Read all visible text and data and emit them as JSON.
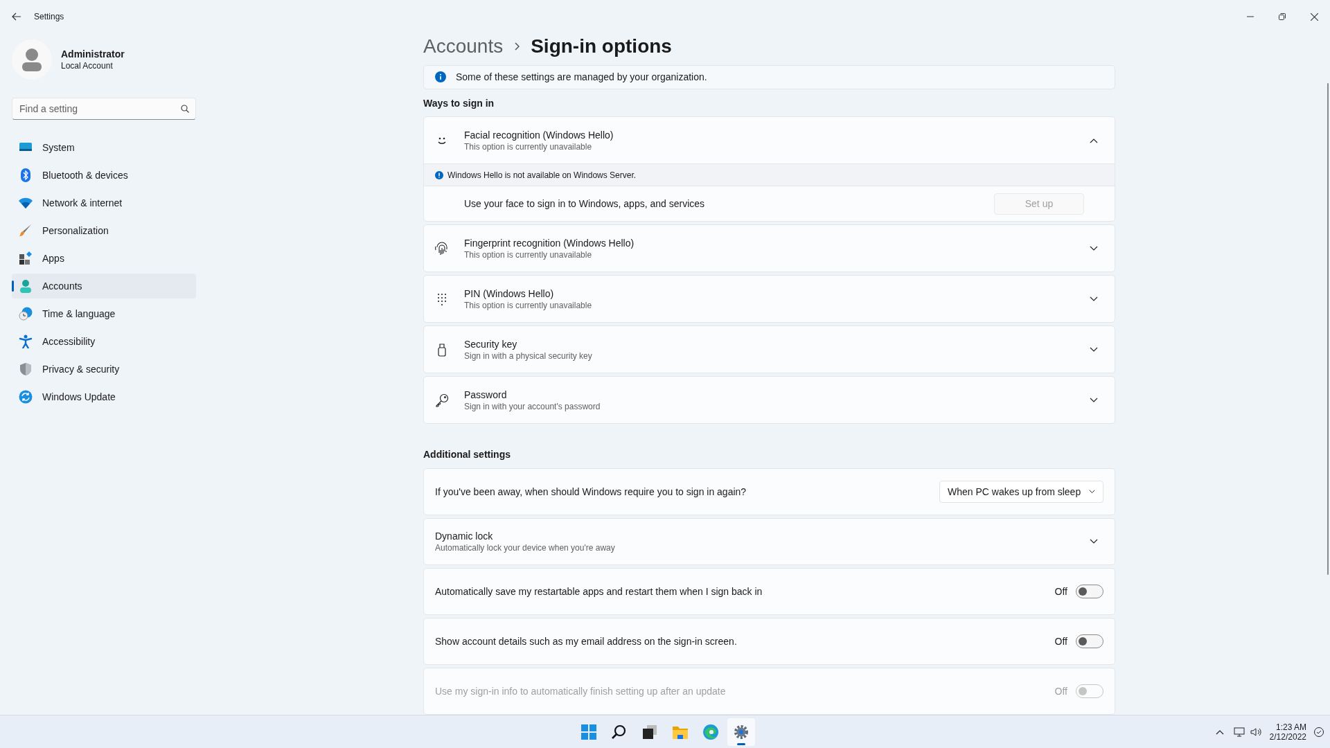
{
  "window": {
    "title": "Settings"
  },
  "user": {
    "name": "Administrator",
    "account_type": "Local Account"
  },
  "search": {
    "placeholder": "Find a setting"
  },
  "nav": [
    {
      "label": "System",
      "selected": false
    },
    {
      "label": "Bluetooth & devices",
      "selected": false
    },
    {
      "label": "Network & internet",
      "selected": false
    },
    {
      "label": "Personalization",
      "selected": false
    },
    {
      "label": "Apps",
      "selected": false
    },
    {
      "label": "Accounts",
      "selected": true
    },
    {
      "label": "Time & language",
      "selected": false
    },
    {
      "label": "Accessibility",
      "selected": false
    },
    {
      "label": "Privacy & security",
      "selected": false
    },
    {
      "label": "Windows Update",
      "selected": false
    }
  ],
  "breadcrumb": {
    "parent": "Accounts",
    "current": "Sign-in options"
  },
  "notice": "Some of these settings are managed by your organization.",
  "ways_heading": "Ways to sign in",
  "sign_in_methods": [
    {
      "title": "Facial recognition (Windows Hello)",
      "subtitle": "This option is currently unavailable",
      "expanded": true,
      "note": "Windows Hello is not available on Windows Server.",
      "detail": "Use your face to sign in to Windows, apps, and services",
      "button": "Set up",
      "button_disabled": true
    },
    {
      "title": "Fingerprint recognition (Windows Hello)",
      "subtitle": "This option is currently unavailable",
      "expanded": false
    },
    {
      "title": "PIN (Windows Hello)",
      "subtitle": "This option is currently unavailable",
      "expanded": false
    },
    {
      "title": "Security key",
      "subtitle": "Sign in with a physical security key",
      "expanded": false
    },
    {
      "title": "Password",
      "subtitle": "Sign in with your account's password",
      "expanded": false
    }
  ],
  "additional_heading": "Additional settings",
  "additional_settings": [
    {
      "kind": "dropdown",
      "label": "If you've been away, when should Windows require you to sign in again?",
      "value": "When PC wakes up from sleep"
    },
    {
      "kind": "expander",
      "title": "Dynamic lock",
      "subtitle": "Automatically lock your device when you're away",
      "expanded": false
    },
    {
      "kind": "toggle",
      "label": "Automatically save my restartable apps and restart them when I sign back in",
      "state_label": "Off",
      "on": false,
      "disabled": false
    },
    {
      "kind": "toggle",
      "label": "Show account details such as my email address on the sign-in screen.",
      "state_label": "Off",
      "on": false,
      "disabled": false
    },
    {
      "kind": "toggle",
      "label": "Use my sign-in info to automatically finish setting up after an update",
      "state_label": "Off",
      "on": false,
      "disabled": true
    }
  ],
  "taskbar": {
    "apps": [
      {
        "selected": false
      },
      {
        "selected": false
      },
      {
        "selected": false
      },
      {
        "selected": false
      },
      {
        "selected": false
      },
      {
        "selected": true
      }
    ],
    "time": "1:23 AM",
    "date": "2/12/2022"
  }
}
